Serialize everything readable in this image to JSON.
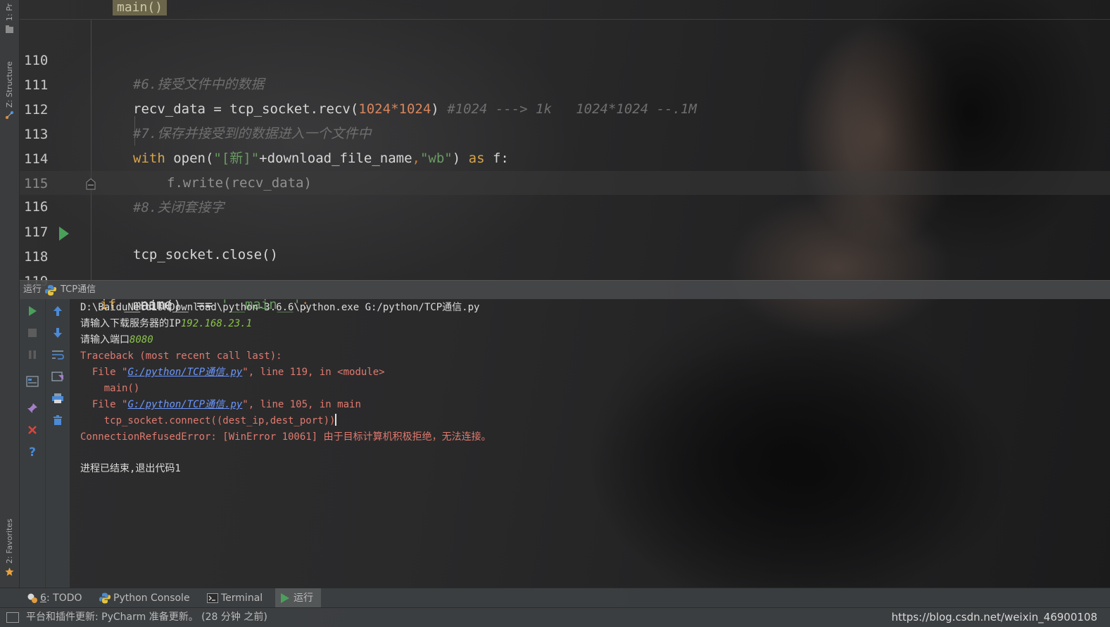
{
  "left_strip": {
    "project_tab": "1: Pr",
    "structure_tab": "Z: Structure",
    "favorites_tab": "2: Favorites"
  },
  "editor": {
    "breadcrumb_hint": "main()",
    "lines": [
      {
        "num": "110",
        "comment": "#6.接受文件中的数据"
      },
      {
        "num": "111",
        "a": "recv_data",
        "b": " = tcp_socket.recv(",
        "n1": "1024",
        "op": "*",
        "n2": "1024",
        "c": ")",
        "comment": "#1024 ---> 1k   1024*1024 --.1M"
      },
      {
        "num": "112",
        "comment": "#7.保存并接受到的数据进入一个文件中"
      },
      {
        "num": "113",
        "kw1": "with",
        "b1": " open(",
        "s1": "\"[新]\"",
        "b2": "+download_file_name",
        "p1": ",",
        "s2": "\"wb\"",
        "b3": ") ",
        "kw2": "as",
        "b4": " f:"
      },
      {
        "num": "114",
        "code": "f.write(recv_data)"
      },
      {
        "num": "115",
        "comment": "#8.关闭套接字"
      },
      {
        "num": "116",
        "code": "tcp_socket.close()"
      },
      {
        "num": "117",
        "code": ""
      },
      {
        "num": "118",
        "kw": "if",
        "b1": " __name__ == ",
        "s1": "'__main__'",
        "p1": ":"
      },
      {
        "num": "119",
        "code": "main()"
      }
    ]
  },
  "run_panel": {
    "label": "运行",
    "config_name": "TCP通信"
  },
  "console": {
    "cmd": "D:\\BaiduNetdiskDownload\\python-3.6.6\\python.exe G:/python/TCP通信.py",
    "prompt_ip": "请输入下载服务器的IP",
    "input_ip": "192.168.23.1",
    "prompt_port": "请输入端口",
    "input_port": "8080",
    "traceback": "Traceback (most recent call last):",
    "file1_pre": "  File \"",
    "file1_link": "G:/python/TCP通信.py",
    "file1_post": "\", line 119, in <module>",
    "code1": "    main()",
    "file2_pre": "  File \"",
    "file2_link": "G:/python/TCP通信.py",
    "file2_post": "\", line 105, in main",
    "code2": "    tcp_socket.connect((dest_ip,dest_port))",
    "error": "ConnectionRefusedError: [WinError 10061] 由于目标计算机积极拒绝，无法连接。",
    "exit": "进程已结束,退出代码1"
  },
  "bottom_tabs": {
    "todo_num": "6",
    "todo_label": ": TODO",
    "python_console": "Python Console",
    "terminal": "Terminal",
    "run": "运行"
  },
  "status_bar": {
    "message": "平台和插件更新: PyCharm 准备更新。 (28 分钟 之前)",
    "watermark": "https://blog.csdn.net/weixin_46900108"
  },
  "colors": {
    "keyword": "#d7a44b",
    "number": "#d8855c",
    "string": "#6a9a62",
    "comment": "#6f6f6f",
    "error_text": "#e07a6e",
    "user_input": "#8bc34a",
    "link": "#6b97ff",
    "run_green": "#4aa05a"
  },
  "icons": [
    "project-icon",
    "structure-icon",
    "favorites-star-icon",
    "run-gutter-icon",
    "bookmark-icon",
    "python-icon",
    "rerun-icon",
    "stop-icon",
    "pause-icon",
    "layout-icon",
    "pin-icon",
    "close-icon",
    "help-icon",
    "up-arrow-icon",
    "down-arrow-icon",
    "soft-wrap-icon",
    "scroll-to-end-icon",
    "print-icon",
    "trash-icon",
    "todo-icon",
    "terminal-icon",
    "run-tab-icon"
  ]
}
